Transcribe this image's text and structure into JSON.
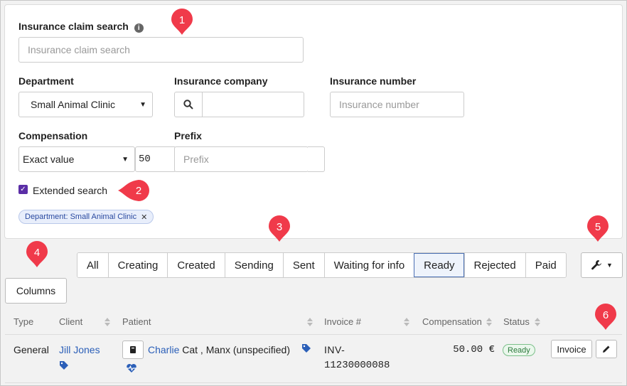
{
  "search": {
    "claim_label": "Insurance claim search",
    "claim_placeholder": "Insurance claim search",
    "department_label": "Department",
    "department_value": "Small Animal Clinic",
    "insurance_company_label": "Insurance company",
    "insurance_company_value": "",
    "insurance_number_label": "Insurance number",
    "insurance_number_placeholder": "Insurance number",
    "compensation_label": "Compensation",
    "compensation_mode": "Exact value",
    "compensation_value": "50",
    "prefix_label": "Prefix",
    "prefix_placeholder": "Prefix",
    "extended_search_label": "Extended search",
    "extended_search_checked": true,
    "filter_chip": "Department: Small Animal Clinic"
  },
  "annotations": [
    "1",
    "2",
    "3",
    "4",
    "5",
    "6"
  ],
  "tabs": [
    {
      "label": "All",
      "active": false
    },
    {
      "label": "Creating",
      "active": false
    },
    {
      "label": "Created",
      "active": false
    },
    {
      "label": "Sending",
      "active": false
    },
    {
      "label": "Sent",
      "active": false
    },
    {
      "label": "Waiting for info",
      "active": false
    },
    {
      "label": "Ready",
      "active": true
    },
    {
      "label": "Rejected",
      "active": false
    },
    {
      "label": "Paid",
      "active": false
    }
  ],
  "columns_button": "Columns",
  "table": {
    "headers": [
      "Type",
      "Client",
      "Patient",
      "Invoice #",
      "Compensation",
      "Status"
    ],
    "row": {
      "type": "General",
      "client": "Jill Jones",
      "patient_name": "Charlie",
      "patient_detail": " Cat , Manx (unspecified)",
      "invoice_1": "INV-",
      "invoice_2": "11230000088",
      "compensation": "50.00 €",
      "status": "Ready",
      "invoice_button": "Invoice"
    }
  },
  "colors": {
    "accent": "#5b2ea6",
    "link": "#2b5fb8",
    "badge": "#f03a4a",
    "ready": "#2d7a3d"
  }
}
